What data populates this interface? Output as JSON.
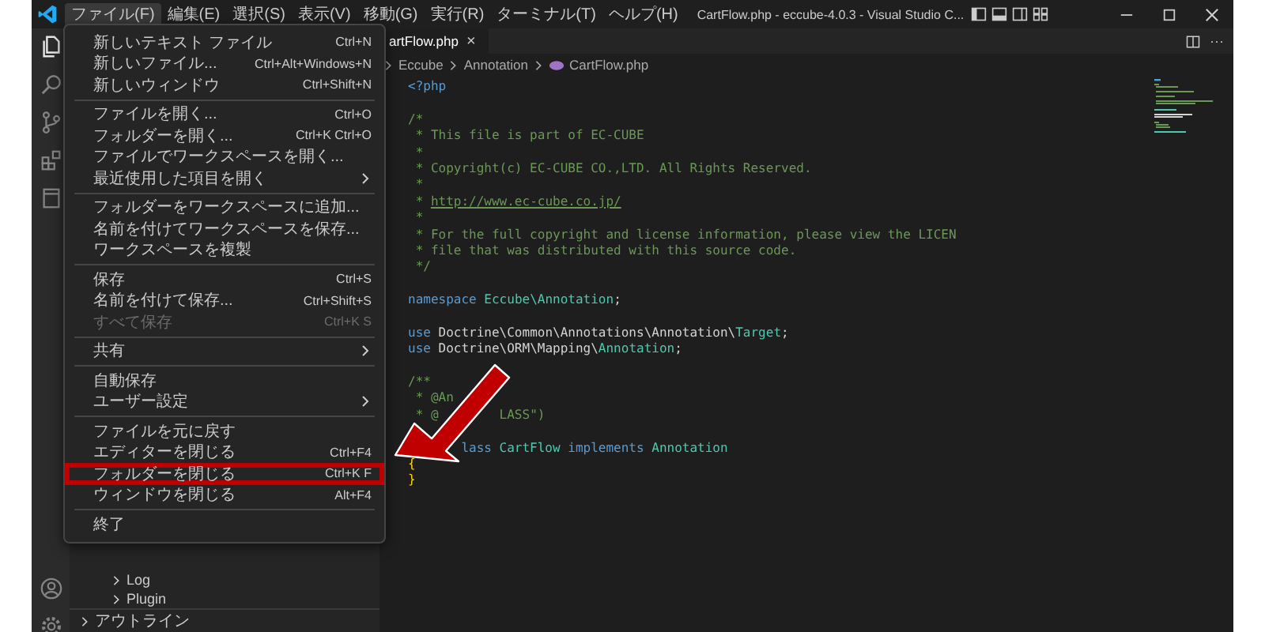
{
  "title_bar": {
    "menus": [
      {
        "label": "ファイル(F)",
        "selected": true
      },
      {
        "label": "編集(E)",
        "selected": false
      },
      {
        "label": "選択(S)",
        "selected": false
      },
      {
        "label": "表示(V)",
        "selected": false
      },
      {
        "label": "移動(G)",
        "selected": false
      },
      {
        "label": "実行(R)",
        "selected": false
      },
      {
        "label": "ターミナル(T)",
        "selected": false
      },
      {
        "label": "ヘルプ(H)",
        "selected": false
      }
    ],
    "title": "CartFlow.php - eccube-4.0.3 - Visual Studio C..."
  },
  "activity_bar": {
    "items": [
      {
        "selected": true
      },
      {
        "selected": false
      },
      {
        "selected": false
      },
      {
        "selected": false
      },
      {
        "selected": false
      }
    ]
  },
  "sidebar": {
    "tree": [
      {
        "label": "Log",
        "expanded": false
      },
      {
        "label": "Plugin",
        "expanded": false
      }
    ],
    "outline": {
      "label": "アウトライン",
      "expanded": false
    }
  },
  "editor": {
    "tab": {
      "label": "artFlow.php",
      "close": "×",
      "selected": true
    },
    "more": "···",
    "breadcrumbs": [
      "Eccube",
      "Annotation",
      "CartFlow.php"
    ],
    "lines": [
      {
        "kind": "code",
        "segments": [
          [
            {
              "t": "<?php",
              "kind": "tag"
            }
          ]
        ]
      },
      {
        "kind": "blank"
      },
      {
        "kind": "code",
        "segments": [
          [
            {
              "t": "/*",
              "kind": "comment"
            }
          ]
        ]
      },
      {
        "kind": "code",
        "segments": [
          [
            {
              "t": " * This file is part of EC-CUBE",
              "kind": "comment"
            }
          ]
        ]
      },
      {
        "kind": "code",
        "segments": [
          [
            {
              "t": " *",
              "kind": "comment"
            }
          ]
        ]
      },
      {
        "kind": "code",
        "segments": [
          [
            {
              "t": " * Copyright(c) EC-CUBE CO.,LTD. All Rights Reserved.",
              "kind": "comment"
            }
          ]
        ]
      },
      {
        "kind": "code",
        "segments": [
          [
            {
              "t": " *",
              "kind": "comment"
            }
          ]
        ]
      },
      {
        "kind": "code",
        "segments": [
          [
            {
              "t": " * ",
              "kind": "comment"
            },
            {
              "t": "http://www.ec-cube.co.jp/",
              "kind": "link"
            }
          ]
        ]
      },
      {
        "kind": "code",
        "segments": [
          [
            {
              "t": " *",
              "kind": "comment"
            }
          ]
        ]
      },
      {
        "kind": "code",
        "segments": [
          [
            {
              "t": " * For the full copyright and license information, please view the LICEN",
              "kind": "comment"
            }
          ]
        ]
      },
      {
        "kind": "code",
        "segments": [
          [
            {
              "t": " * file that was distributed with this source code.",
              "kind": "comment"
            }
          ]
        ]
      },
      {
        "kind": "code",
        "segments": [
          [
            {
              "t": " */",
              "kind": "comment"
            }
          ]
        ]
      },
      {
        "kind": "blank"
      },
      {
        "kind": "code",
        "segments": [
          [
            {
              "t": "namespace",
              "kind": "keyword"
            },
            {
              "t": " Eccube\\Annotation",
              "kind": "type"
            },
            {
              "t": ";",
              "kind": "plain"
            }
          ]
        ]
      },
      {
        "kind": "blank"
      },
      {
        "kind": "code",
        "segments": [
          [
            {
              "t": "use",
              "kind": "keyword"
            },
            {
              "t": " Doctrine\\Common\\Annotations\\Annotation\\",
              "kind": "plain"
            },
            {
              "t": "Target",
              "kind": "type"
            },
            {
              "t": ";",
              "kind": "plain"
            }
          ]
        ]
      },
      {
        "kind": "code",
        "segments": [
          [
            {
              "t": "use",
              "kind": "keyword"
            },
            {
              "t": " Doctrine\\ORM\\Mapping\\",
              "kind": "plain"
            },
            {
              "t": "Annotation",
              "kind": "type"
            },
            {
              "t": ";",
              "kind": "plain"
            }
          ]
        ]
      },
      {
        "kind": "blank"
      },
      {
        "kind": "code",
        "segments": [
          [
            {
              "t": "/**",
              "kind": "comment"
            }
          ]
        ]
      },
      {
        "kind": "code",
        "segments": [
          [
            {
              "t": " * @An",
              "kind": "comment"
            }
          ]
        ]
      },
      {
        "kind": "code",
        "segments": [
          [
            {
              "t": " * @",
              "kind": "comment"
            }
          ],
          [
            {
              "t": "        LASS\")",
              "kind": "comment"
            }
          ]
        ]
      },
      {
        "kind": "blank"
      },
      {
        "kind": "code",
        "segments": [
          [
            {
              "t": "       lass",
              "kind": "keyword"
            },
            {
              "t": " CartFlow",
              "kind": "type"
            },
            {
              "t": " implements",
              "kind": "keyword"
            },
            {
              "t": " Annotation",
              "kind": "type"
            }
          ]
        ]
      },
      {
        "kind": "code",
        "segments": [
          [
            {
              "t": "{",
              "kind": "brace"
            }
          ]
        ]
      },
      {
        "kind": "code",
        "segments": [
          [
            {
              "t": "}",
              "kind": "brace"
            }
          ]
        ]
      }
    ]
  },
  "menu": {
    "items": [
      {
        "kind": "item",
        "label": "新しいテキスト ファイル",
        "shortcut": "Ctrl+N",
        "submenu": false,
        "disabled": false,
        "highlighted": false
      },
      {
        "kind": "item",
        "label": "新しいファイル...",
        "shortcut": "Ctrl+Alt+Windows+N",
        "submenu": false,
        "disabled": false,
        "highlighted": false
      },
      {
        "kind": "item",
        "label": "新しいウィンドウ",
        "shortcut": "Ctrl+Shift+N",
        "submenu": false,
        "disabled": false,
        "highlighted": false
      },
      {
        "kind": "separator"
      },
      {
        "kind": "item",
        "label": "ファイルを開く...",
        "shortcut": "Ctrl+O",
        "submenu": false,
        "disabled": false,
        "highlighted": false
      },
      {
        "kind": "item",
        "label": "フォルダーを開く...",
        "shortcut": "Ctrl+K Ctrl+O",
        "submenu": false,
        "disabled": false,
        "highlighted": false
      },
      {
        "kind": "item",
        "label": "ファイルでワークスペースを開く...",
        "submenu": false,
        "disabled": false,
        "highlighted": false
      },
      {
        "kind": "item",
        "label": "最近使用した項目を開く",
        "submenu": true,
        "disabled": false,
        "highlighted": false
      },
      {
        "kind": "separator"
      },
      {
        "kind": "item",
        "label": "フォルダーをワークスペースに追加...",
        "submenu": false,
        "disabled": false,
        "highlighted": false
      },
      {
        "kind": "item",
        "label": "名前を付けてワークスペースを保存...",
        "submenu": false,
        "disabled": false,
        "highlighted": false
      },
      {
        "kind": "item",
        "label": "ワークスペースを複製",
        "submenu": false,
        "disabled": false,
        "highlighted": false
      },
      {
        "kind": "separator"
      },
      {
        "kind": "item",
        "label": "保存",
        "shortcut": "Ctrl+S",
        "submenu": false,
        "disabled": false,
        "highlighted": false
      },
      {
        "kind": "item",
        "label": "名前を付けて保存...",
        "shortcut": "Ctrl+Shift+S",
        "submenu": false,
        "disabled": false,
        "highlighted": false
      },
      {
        "kind": "item",
        "label": "すべて保存",
        "shortcut": "Ctrl+K S",
        "submenu": false,
        "disabled": true,
        "highlighted": false
      },
      {
        "kind": "separator"
      },
      {
        "kind": "item",
        "label": "共有",
        "submenu": true,
        "disabled": false,
        "highlighted": false
      },
      {
        "kind": "separator"
      },
      {
        "kind": "item",
        "label": "自動保存",
        "submenu": false,
        "disabled": false,
        "highlighted": false
      },
      {
        "kind": "item",
        "label": "ユーザー設定",
        "submenu": true,
        "disabled": false,
        "highlighted": false
      },
      {
        "kind": "separator"
      },
      {
        "kind": "item",
        "label": "ファイルを元に戻す",
        "submenu": false,
        "disabled": false,
        "highlighted": false
      },
      {
        "kind": "item",
        "label": "エディターを閉じる",
        "shortcut": "Ctrl+F4",
        "submenu": false,
        "disabled": false,
        "highlighted": false
      },
      {
        "kind": "item",
        "label": "フォルダーを閉じる",
        "shortcut": "Ctrl+K F",
        "submenu": false,
        "disabled": false,
        "highlighted": true
      },
      {
        "kind": "item",
        "label": "ウィンドウを閉じる",
        "shortcut": "Alt+F4",
        "submenu": false,
        "disabled": false,
        "highlighted": false
      },
      {
        "kind": "separator"
      },
      {
        "kind": "item",
        "label": "終了",
        "submenu": false,
        "disabled": false,
        "highlighted": false
      }
    ]
  }
}
